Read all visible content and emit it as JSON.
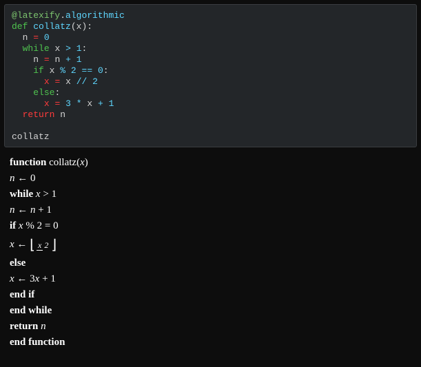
{
  "code": {
    "decorator_at": "@",
    "decorator_mod": "latexify",
    "decorator_dot": ".",
    "decorator_attr": "algorithmic",
    "def_kw": "def",
    "fn_name": "collatz",
    "fn_paren_open": "(",
    "param": "x",
    "fn_paren_close": ")",
    "colon": ":",
    "n": "n",
    "eq": "=",
    "zero": "0",
    "while_kw": "while",
    "x": "x",
    "gt": ">",
    "one": "1",
    "plus": "+",
    "if_kw": "if",
    "mod": "%",
    "two": "2",
    "eqeq": "==",
    "floordiv": "//",
    "else_kw": "else",
    "three": "3",
    "star": "*",
    "return_kw": "return"
  },
  "output": {
    "text": "collatz"
  },
  "algo": {
    "function_kw": "function",
    "name": "collatz",
    "open": "(",
    "param": "x",
    "close": ")",
    "n": "n",
    "arrow": "←",
    "zero": "0",
    "while_kw": "while",
    "x": "x",
    "gt": ">",
    "one": "1",
    "plus": "+",
    "if_kw": "if",
    "mod": "%",
    "two": "2",
    "eq": "=",
    "lfloor": "⌊",
    "rfloor": "⌋",
    "frac_num": "x",
    "frac_den": "2",
    "else_kw": "else",
    "three": "3",
    "endif": "end if",
    "endwhile": "end while",
    "return_kw": "return",
    "endfunction": "end function"
  }
}
